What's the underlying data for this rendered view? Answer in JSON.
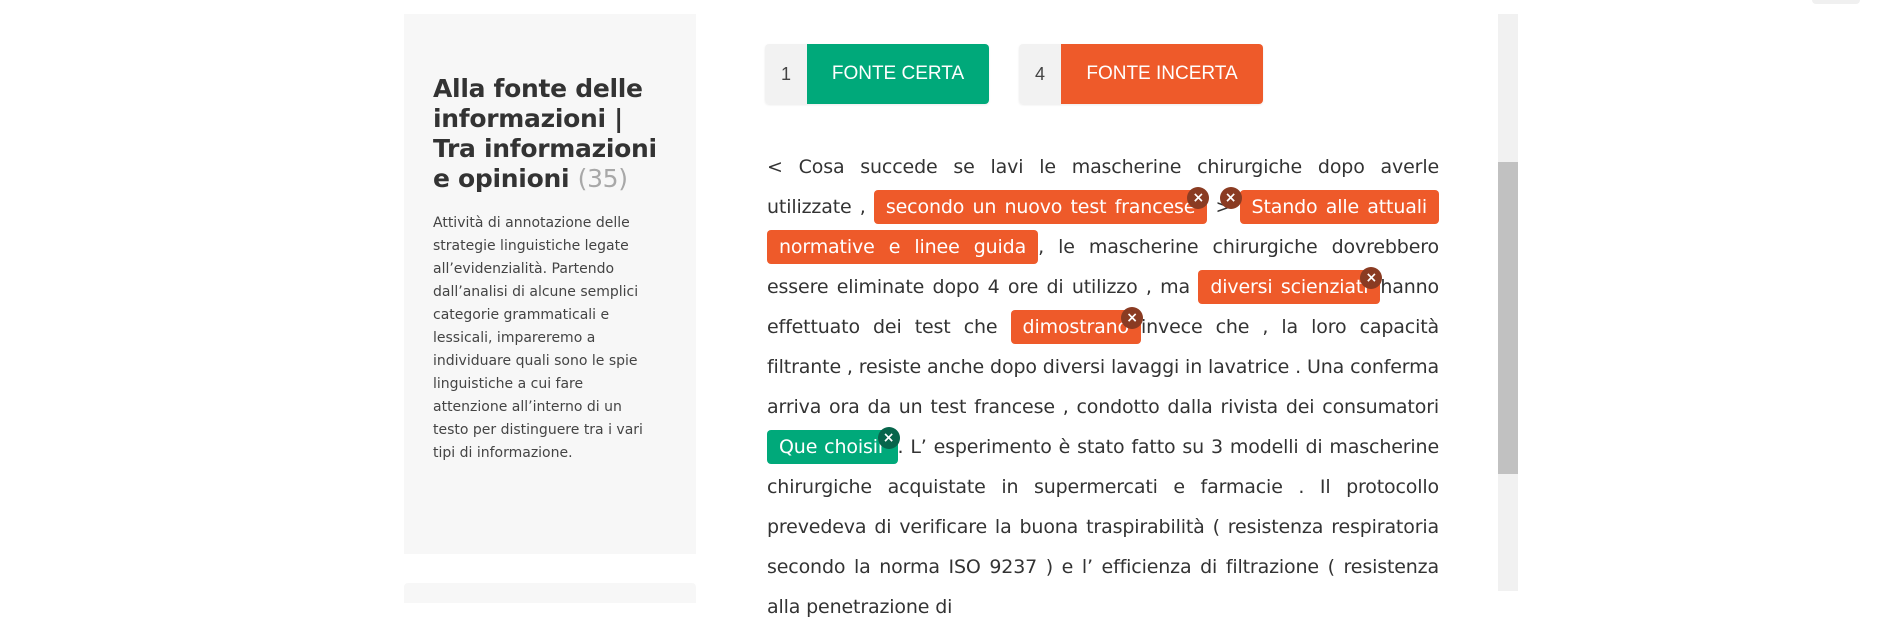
{
  "sidebar": {
    "title": "Alla fonte delle informazioni | Tra informazioni e opinioni",
    "count": "(35)",
    "description": "Attività di annotazione delle strategie linguistiche legate all’evidenzialità. Partendo dall’analisi di alcune semplici categorie grammaticali e lessicali, impareremo a individuare quali sono le spie linguistiche a cui fare attenzione all’interno di un testo per distinguere tra i vari tipi di informazione."
  },
  "counters": {
    "certa": {
      "count": "1",
      "label": "FONTE CERTA",
      "color": "#00a97a"
    },
    "incerta": {
      "count": "4",
      "label": "FONTE INCERTA",
      "color": "#ee5a2a"
    }
  },
  "text": {
    "t1": "< Cosa succede se lavi le mascherine chirurgiche dopo averle utilizzate , ",
    "tag1": "secondo un nuovo test francese",
    "t2": " > ",
    "tag2": "Stando alle attuali normative e linee guida",
    "t3": ", le mascherine chirurgiche dovrebbero essere eliminate dopo 4 ore di utilizzo , ma ",
    "tag3": "diversi scienziati",
    "t4": "hanno effettuato dei test che ",
    "tag4": "dimostrano",
    "t5": "invece che , la loro capacità filtrante , resiste anche dopo diversi lavaggi in lavatrice . Una conferma arriva ora da un test francese , condotto dalla rivista dei consumatori ",
    "tag5": "Que choisir",
    "t6": ". L’ esperimento è stato fatto su 3 modelli di mascherine chirurgiche acquistate in supermercati e farmacie . Il protocollo prevedeva di verificare la buona traspirabilità ( resistenza respiratoria secondo la norma ISO 9237 ) e l’ efficienza di filtrazione ( resistenza alla penetrazione di",
    "close_symbol": "×"
  }
}
